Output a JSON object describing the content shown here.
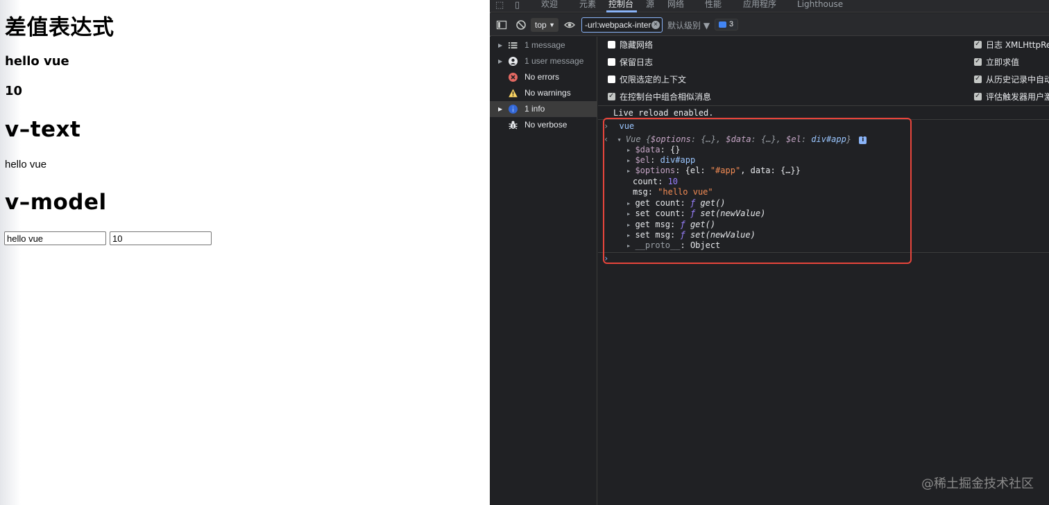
{
  "page": {
    "h1_interp": "差值表达式",
    "h3_msg": "hello vue",
    "h3_count": "10",
    "h1_vtext": "v–text",
    "p_vtext": "hello vue",
    "h1_vmodel": "v–model",
    "input_msg": "hello vue",
    "input_count": "10"
  },
  "devtools": {
    "tabs": [
      "欢迎",
      "元素",
      "控制台",
      "源",
      "网络",
      "性能",
      "应用程序",
      "Lighthouse"
    ],
    "active_tab": "控制台",
    "toolbar": {
      "context": "top",
      "filter": "-url:webpack-inter",
      "levels": "默认级别 ▼",
      "issues_count": "3"
    },
    "sidebar": [
      {
        "label": "1 message",
        "icon": "list-icon"
      },
      {
        "label": "1 user message",
        "icon": "user-icon"
      },
      {
        "label": "No errors",
        "icon": "error-icon"
      },
      {
        "label": "No warnings",
        "icon": "warning-icon"
      },
      {
        "label": "1 info",
        "icon": "info-icon"
      },
      {
        "label": "No verbose",
        "icon": "bug-icon"
      }
    ],
    "settings_left": [
      {
        "label": "隐藏网络",
        "checked": false
      },
      {
        "label": "保留日志",
        "checked": false
      },
      {
        "label": "仅限选定的上下文",
        "checked": false
      },
      {
        "label": "在控制台中组合相似消息",
        "checked": true
      }
    ],
    "settings_right": [
      {
        "label": "日志 XMLHttpRequ",
        "checked": true
      },
      {
        "label": "立即求值",
        "checked": true
      },
      {
        "label": "从历史记录中自动完",
        "checked": true
      },
      {
        "label": "评估触发器用户激活",
        "checked": true
      }
    ],
    "console": {
      "live_reload": "Live reload enabled.",
      "input_cmd": "vue",
      "vue_summary_head": "Vue {",
      "vue_options_key": "$options",
      "vue_data_key": "$data",
      "vue_el_key": "$el",
      "vue_el_val": "div#app",
      "data_line_key": "$data",
      "data_line_val": "{}",
      "el_line_key": "$el",
      "el_line_val": "div#app",
      "options_line_key": "$options",
      "options_line_val_pre": "{el: ",
      "options_line_str": "\"#app\"",
      "options_line_val_post": ", data: {…}}",
      "count_key": "count",
      "count_val": "10",
      "msg_key": "msg",
      "msg_val": "\"hello vue\"",
      "get_count_key": "get count",
      "get_count_val": "get()",
      "set_count_key": "set count",
      "set_count_val": "set(newValue)",
      "get_msg_key": "get msg",
      "get_msg_val": "get()",
      "set_msg_key": "set msg",
      "set_msg_val": "set(newValue)",
      "proto_key": "__proto__",
      "proto_val": "Object"
    }
  },
  "watermark": "@稀土掘金技术社区",
  "colors": {
    "devtools_bg": "#202124",
    "highlight_box": "#e8453c",
    "accent": "#8ab4f8"
  }
}
